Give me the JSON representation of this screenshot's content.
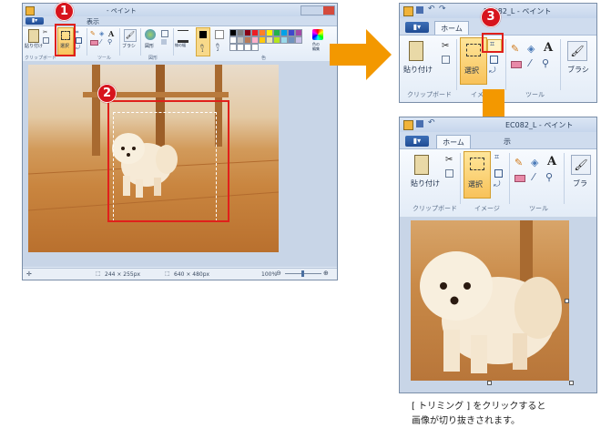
{
  "window1": {
    "title": "- ペイント",
    "file_tab": "▮▾",
    "ribbon": {
      "paste_label": "貼り付け",
      "select_label": "選択",
      "brush_label": "ブラシ",
      "shapes_label": "図形",
      "size_label": "線の幅",
      "color1_label": "色\n1",
      "color1_sub": "1",
      "color2_label": "色\n2",
      "color2_sub": "2",
      "edit_colors_label": "色の\n編集",
      "group_clipboard": "クリップボード",
      "group_tools": "ツール",
      "group_shapes": "図形",
      "group_colors": "色"
    },
    "status": {
      "selection_size": "244 × 255px",
      "image_size": "640 × 480px",
      "zoom": "100%"
    }
  },
  "window2": {
    "title": "EC082_L - ペイント",
    "home_tab": "ホーム",
    "paste_label": "貼り付け",
    "select_label": "選択",
    "brush_label": "ブラシ",
    "group_clipboard": "クリップボード",
    "group_image": "イメージ",
    "group_tools": "ツール"
  },
  "window3": {
    "title": "EC082_L - ペイント",
    "home_tab": "ホーム",
    "display_tab": "示",
    "paste_label": "貼り付け",
    "select_label": "選択",
    "brush_label": "ブラ",
    "group_clipboard": "クリップボード",
    "group_image": "イメージ",
    "group_tools": "ツール"
  },
  "steps": {
    "one": "1",
    "two": "2",
    "three": "3"
  },
  "caption": {
    "line1": "[ トリミング ] をクリックすると",
    "line2": "画像が切り抜きされます。"
  },
  "colors": {
    "accent_red": "#e0201b",
    "arrow_orange": "#f39800",
    "ribbon_blue": "#dfe9f5"
  },
  "icons": [
    "paste-icon",
    "select-icon",
    "crop-icon",
    "pencil-icon",
    "fill-icon",
    "text-icon",
    "eraser-icon",
    "picker-icon",
    "magnifier-icon",
    "brush-icon",
    "zoom-out-icon",
    "zoom-in-icon"
  ]
}
